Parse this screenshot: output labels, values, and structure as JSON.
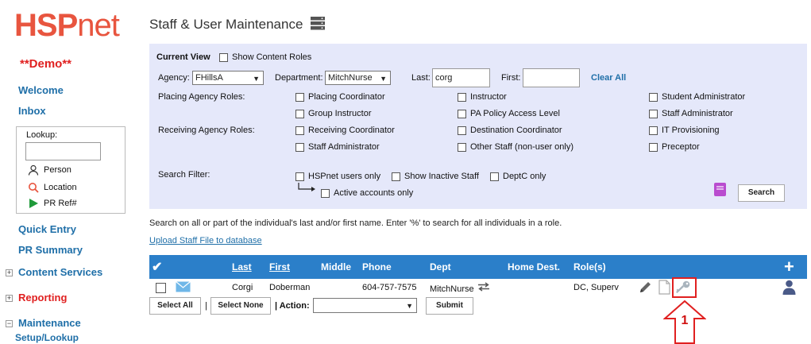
{
  "brand": {
    "logo_hsp": "HSP",
    "logo_net": "net",
    "demo": "**Demo**"
  },
  "sidebar": {
    "welcome": "Welcome",
    "inbox": "Inbox",
    "lookup_label": "Lookup:",
    "lookup_value": "",
    "person": "Person",
    "location": "Location",
    "pr_ref": "PR Ref#",
    "quick_entry": "Quick Entry",
    "pr_summary": "PR Summary",
    "content_services": "Content Services",
    "reporting": "Reporting",
    "maintenance": "Maintenance",
    "setup_lookup": "Setup/Lookup"
  },
  "page": {
    "title": "Staff & User Maintenance"
  },
  "filters": {
    "current_view": "Current View",
    "show_content_roles": "Show Content Roles",
    "agency_label": "Agency:",
    "agency_value": "FHillsA",
    "department_label": "Department:",
    "department_value": "MitchNurse",
    "last_label": "Last:",
    "last_value": "corg",
    "first_label": "First:",
    "first_value": "",
    "clear_all": "Clear All",
    "placing_roles_label": "Placing Agency Roles:",
    "receiving_roles_label": "Receiving Agency Roles:",
    "roles": {
      "placing_coordinator": "Placing Coordinator",
      "instructor": "Instructor",
      "student_administrator": "Student Administrator",
      "group_instructor": "Group Instructor",
      "pa_policy_access_level": "PA Policy Access Level",
      "staff_administrator_right": "Staff Administrator",
      "receiving_coordinator": "Receiving Coordinator",
      "destination_coordinator": "Destination Coordinator",
      "it_provisioning": "IT Provisioning",
      "staff_administrator_left": "Staff Administrator",
      "other_staff": "Other Staff (non-user only)",
      "preceptor": "Preceptor"
    },
    "search_filter_label": "Search Filter:",
    "hspnet_users_only": "HSPnet users only",
    "show_inactive_staff": "Show Inactive Staff",
    "deptc_only": "DeptC only",
    "active_accounts_only": "Active accounts only",
    "search_button": "Search"
  },
  "hint": "Search on all or part of the individual's last and/or first name. Enter '%' to search for all individuals in a role.",
  "upload_link": "Upload Staff File to database",
  "table": {
    "headers": {
      "check": "✔",
      "last": "Last",
      "first": "First",
      "middle": "Middle",
      "phone": "Phone",
      "dept": "Dept",
      "home_dest": "Home Dest.",
      "roles": "Role(s)",
      "add": "+"
    },
    "rows": [
      {
        "last": "Corgi",
        "first": "Doberman",
        "middle": "",
        "phone": "604-757-7575",
        "dept": "MitchNurse",
        "home_dest": "",
        "roles": "DC, Superv"
      }
    ]
  },
  "actions": {
    "select_all": "Select All",
    "select_none": "Select None",
    "sep1": "|",
    "action_label": "| Action:",
    "action_value": "",
    "submit": "Submit"
  },
  "annotation": {
    "callout_number": "1"
  },
  "colors": {
    "brand": "#e8553f",
    "link": "#1f6fa8",
    "panel_bg": "#e5e8fa",
    "table_header": "#2b7fc9",
    "callout": "#e02020"
  }
}
